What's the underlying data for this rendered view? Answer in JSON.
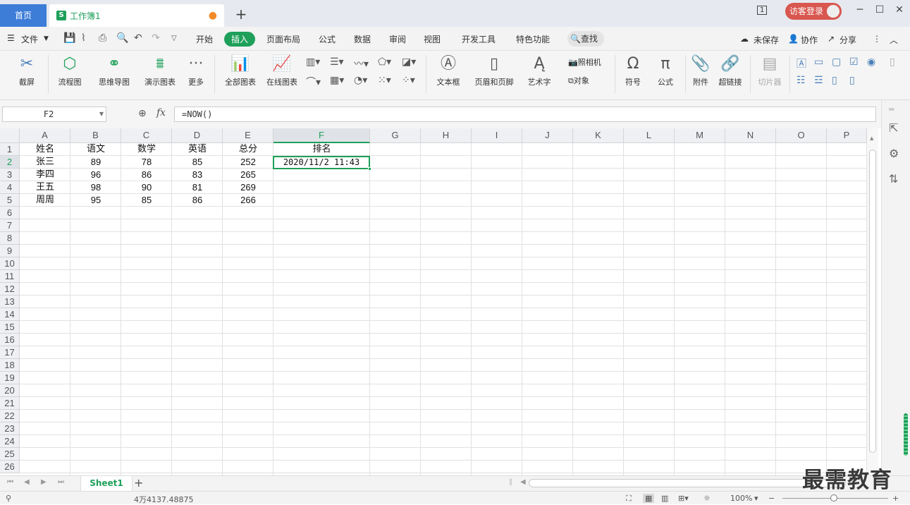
{
  "titlebar": {
    "home_tab": "首页",
    "doc_icon": "S",
    "doc_tab": "工作簿1",
    "login_label": "访客登录",
    "page_indicator": "1"
  },
  "menubar": {
    "file": "文件",
    "items": [
      "开始",
      "插入",
      "页面布局",
      "公式",
      "数据",
      "审阅",
      "视图",
      "开发工具",
      "特色功能"
    ],
    "active_item": "插入",
    "search": "查找",
    "unsaved": "未保存",
    "collab": "协作",
    "share": "分享"
  },
  "ribbon": {
    "screenshot": "截屏",
    "flowchart": "流程图",
    "mindmap": "思维导图",
    "demo_chart": "演示图表",
    "more": "更多",
    "all_charts": "全部图表",
    "online_chart": "在线图表",
    "textbox": "文本框",
    "header_footer": "页眉和页脚",
    "art_text": "艺术字",
    "camera": "照相机",
    "object": "对象",
    "symbol": "符号",
    "formula": "公式",
    "attachment": "附件",
    "hyperlink": "超链接",
    "slicer": "切片器"
  },
  "formula_bar": {
    "cell_ref": "F2",
    "fx": "fx",
    "formula": "=NOW()"
  },
  "columns": [
    "A",
    "B",
    "C",
    "D",
    "E",
    "F",
    "G",
    "H",
    "I",
    "J",
    "K",
    "L",
    "M",
    "N",
    "O",
    "P"
  ],
  "row_numbers": [
    "1",
    "2",
    "3",
    "4",
    "5",
    "6",
    "7",
    "8",
    "9",
    "10",
    "11",
    "12",
    "13",
    "14",
    "15",
    "16",
    "17",
    "18",
    "19",
    "20",
    "21",
    "22",
    "23",
    "24",
    "25",
    "26"
  ],
  "table": {
    "headers": [
      "姓名",
      "语文",
      "数学",
      "英语",
      "总分",
      "排名"
    ],
    "rows": [
      [
        "张三",
        "89",
        "78",
        "85",
        "252"
      ],
      [
        "李四",
        "96",
        "86",
        "83",
        "265"
      ],
      [
        "王五",
        "98",
        "90",
        "81",
        "269"
      ],
      [
        "周周",
        "95",
        "85",
        "86",
        "266"
      ]
    ],
    "active_cell_value": "2020/11/2 11:43"
  },
  "sheets": {
    "active": "Sheet1"
  },
  "statusbar": {
    "stats": "4万4137.48875",
    "zoom": "100%"
  },
  "watermark": "最需教育",
  "colors": {
    "accent": "#1ea05a",
    "home_tab": "#3d7dd8",
    "login": "#d8574f"
  }
}
